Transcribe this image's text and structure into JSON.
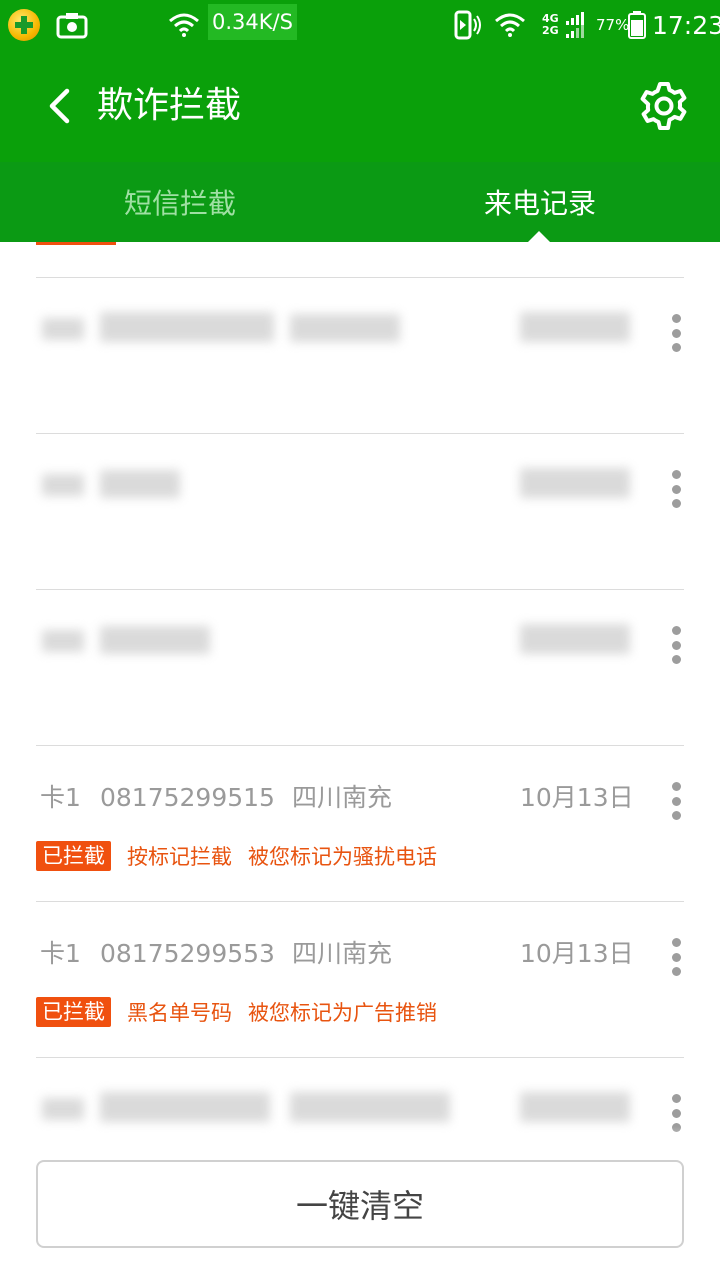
{
  "status_bar": {
    "net_speed": "0.34K/S",
    "network_top": "4G",
    "network_bottom": "2G",
    "battery_percent": "77%",
    "time": "17:23"
  },
  "header": {
    "title": "欺诈拦截",
    "back_icon": "chevron-left-icon",
    "settings_icon": "gear-icon",
    "color": "#0aa00a"
  },
  "tabs": [
    {
      "label": "短信拦截",
      "active": false
    },
    {
      "label": "来电记录",
      "active": true
    }
  ],
  "records": [
    {
      "sim": "卡1",
      "number": "08175299515",
      "location": "四川南充",
      "date": "10月13日",
      "badge": "已拦截",
      "reason": "按标记拦截",
      "detail": "被您标记为骚扰电话"
    },
    {
      "sim": "卡1",
      "number": "08175299553",
      "location": "四川南充",
      "date": "10月13日",
      "badge": "已拦截",
      "reason": "黑名单号码",
      "detail": "被您标记为广告推销"
    }
  ],
  "clear_button": {
    "label": "一键清空"
  },
  "colors": {
    "accent": "#0aa00a",
    "badge": "#f0500f",
    "warning_text": "#e85410"
  }
}
